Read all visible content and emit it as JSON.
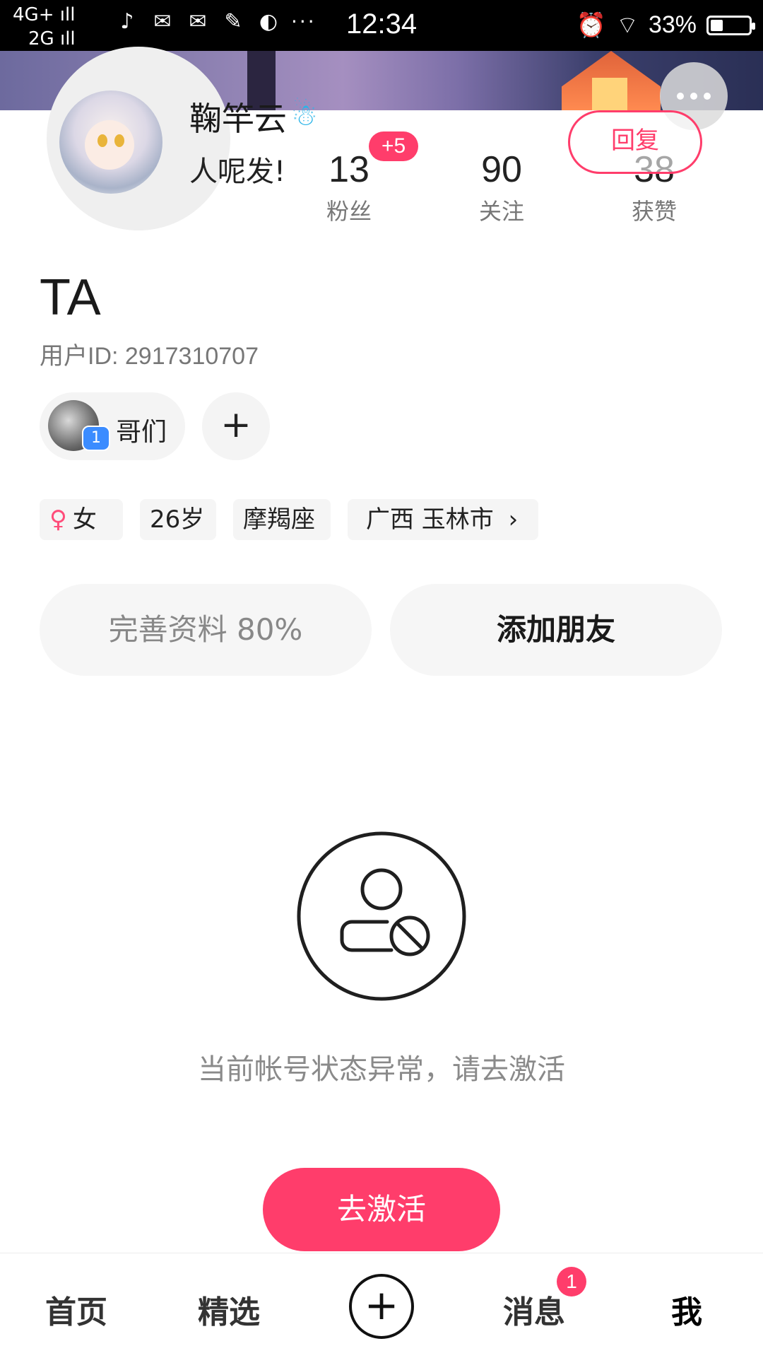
{
  "status_bar": {
    "network_top": "4G+",
    "network_bottom": "2G",
    "signal_bars": "ıll",
    "notification_icons": [
      "music-app-icon",
      "mail-icon",
      "mail-icon",
      "paint-icon",
      "planet-icon"
    ],
    "more": "···",
    "time": "12:34",
    "battery_percent": "33%",
    "battery_level": 0.33
  },
  "profile": {
    "username": "鞠竿云",
    "username_emoji": "☃",
    "bio": "人呢发!",
    "display_name": "TA",
    "user_id": "用户ID: 2917310707",
    "reply_label": "回复",
    "stats": {
      "followers": {
        "value": "13",
        "label": "粉丝",
        "badge": "+5"
      },
      "following": {
        "value": "90",
        "label": "关注"
      },
      "likes": {
        "value": "38",
        "label": "获赞"
      }
    }
  },
  "group": {
    "label": "哥们",
    "badge": "1",
    "add_symbol": "+"
  },
  "tags": {
    "gender_icon": "♀",
    "gender": "女",
    "age": "26岁",
    "zodiac": "摩羯座",
    "location": "广西 玉林市",
    "location_chevron": "›"
  },
  "actions": {
    "complete_profile": "完善资料 80%",
    "add_friend": "添加朋友"
  },
  "state": {
    "message": "当前帐号状态异常，请去激活",
    "activate_label": "去激活"
  },
  "nav": {
    "home": "首页",
    "featured": "精选",
    "create": "+",
    "messages": "消息",
    "messages_badge": "1",
    "me": "我"
  },
  "colors": {
    "accent": "#ff3d6b",
    "group_badge": "#3b8cff"
  }
}
